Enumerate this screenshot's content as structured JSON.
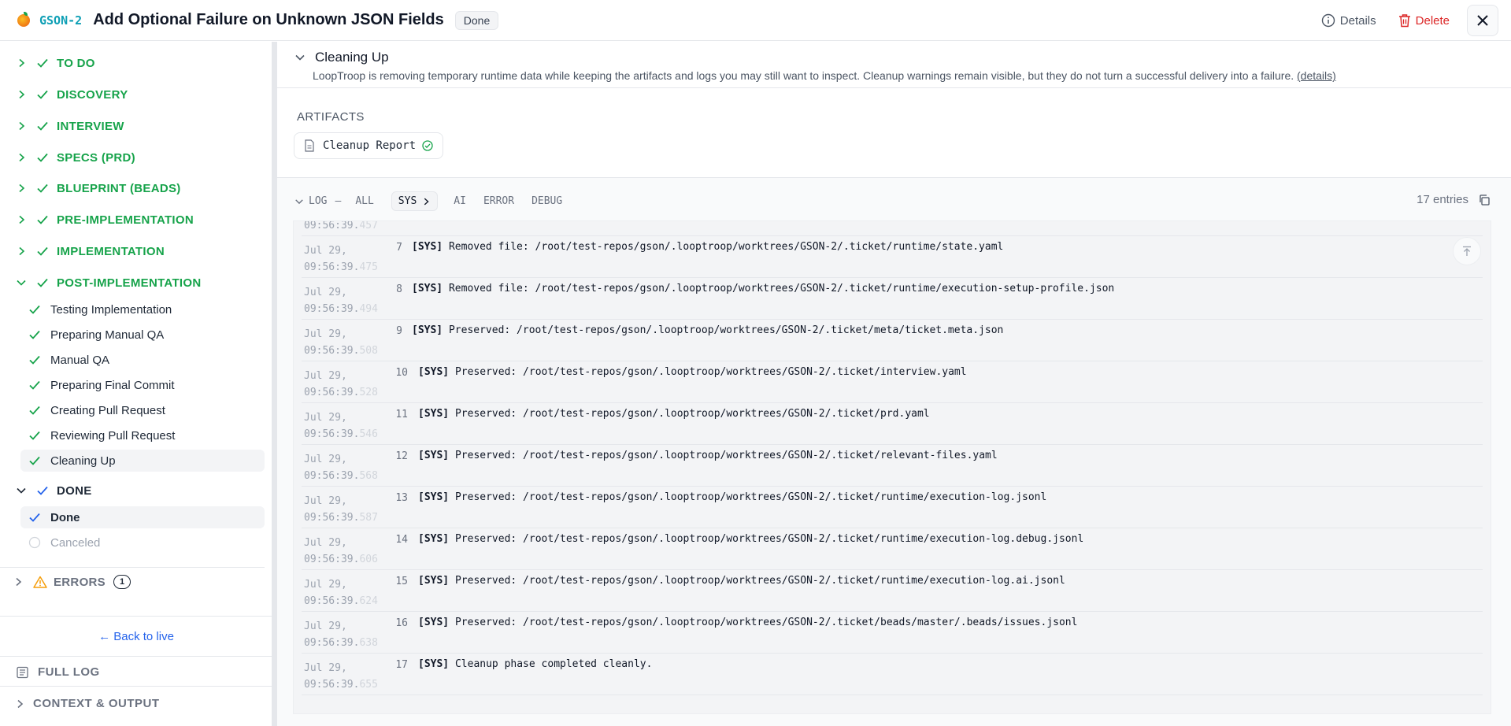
{
  "header": {
    "ticket_id": "GSON-2",
    "title": "Add Optional Failure on Unknown JSON Fields",
    "status": "Done",
    "details_label": "Details",
    "delete_label": "Delete"
  },
  "sidebar": {
    "phases": [
      {
        "label": "TO DO"
      },
      {
        "label": "DISCOVERY"
      },
      {
        "label": "INTERVIEW"
      },
      {
        "label": "SPECS (PRD)"
      },
      {
        "label": "BLUEPRINT (BEADS)"
      },
      {
        "label": "PRE-IMPLEMENTATION"
      },
      {
        "label": "IMPLEMENTATION"
      },
      {
        "label": "POST-IMPLEMENTATION"
      }
    ],
    "post_steps": [
      {
        "label": "Testing Implementation"
      },
      {
        "label": "Preparing Manual QA"
      },
      {
        "label": "Manual QA"
      },
      {
        "label": "Preparing Final Commit"
      },
      {
        "label": "Creating Pull Request"
      },
      {
        "label": "Reviewing Pull Request"
      },
      {
        "label": "Cleaning Up"
      }
    ],
    "done_phase": {
      "label": "DONE"
    },
    "done_steps": [
      {
        "label": "Done"
      },
      {
        "label": "Canceled"
      }
    ],
    "errors": {
      "label": "ERRORS",
      "count": "1"
    },
    "back_to_live": "← Back to live",
    "full_log": "FULL LOG",
    "context_output": "CONTEXT & OUTPUT"
  },
  "main": {
    "section_title": "Cleaning Up",
    "description": "LoopTroop is removing temporary runtime data while keeping the artifacts and logs you may still want to inspect. Cleanup warnings remain visible, but they do not turn a successful delivery into a failure.",
    "details_link": "(details)",
    "artifacts_label": "ARTIFACTS",
    "artifact": "Cleanup Report",
    "log": {
      "label": "LOG",
      "dash": "—",
      "tabs": [
        "ALL",
        "SYS",
        "AI",
        "ERROR",
        "DEBUG"
      ],
      "entries_count": "17 entries",
      "partial_time": {
        "hms": "09:56:39.",
        "ms": "457"
      },
      "rows": [
        {
          "date": "Jul 29,",
          "hms": "09:56:39.",
          "ms": "475",
          "num": "7",
          "tag": "[SYS]",
          "msg": "Removed file: /root/test-repos/gson/.looptroop/worktrees/GSON-2/.ticket/runtime/state.yaml"
        },
        {
          "date": "Jul 29,",
          "hms": "09:56:39.",
          "ms": "494",
          "num": "8",
          "tag": "[SYS]",
          "msg": "Removed file: /root/test-repos/gson/.looptroop/worktrees/GSON-2/.ticket/runtime/execution-setup-profile.json"
        },
        {
          "date": "Jul 29,",
          "hms": "09:56:39.",
          "ms": "508",
          "num": "9",
          "tag": "[SYS]",
          "msg": "Preserved: /root/test-repos/gson/.looptroop/worktrees/GSON-2/.ticket/meta/ticket.meta.json"
        },
        {
          "date": "Jul 29,",
          "hms": "09:56:39.",
          "ms": "528",
          "num": "10",
          "tag": "[SYS]",
          "msg": "Preserved: /root/test-repos/gson/.looptroop/worktrees/GSON-2/.ticket/interview.yaml"
        },
        {
          "date": "Jul 29,",
          "hms": "09:56:39.",
          "ms": "546",
          "num": "11",
          "tag": "[SYS]",
          "msg": "Preserved: /root/test-repos/gson/.looptroop/worktrees/GSON-2/.ticket/prd.yaml"
        },
        {
          "date": "Jul 29,",
          "hms": "09:56:39.",
          "ms": "568",
          "num": "12",
          "tag": "[SYS]",
          "msg": "Preserved: /root/test-repos/gson/.looptroop/worktrees/GSON-2/.ticket/relevant-files.yaml"
        },
        {
          "date": "Jul 29,",
          "hms": "09:56:39.",
          "ms": "587",
          "num": "13",
          "tag": "[SYS]",
          "msg": "Preserved: /root/test-repos/gson/.looptroop/worktrees/GSON-2/.ticket/runtime/execution-log.jsonl"
        },
        {
          "date": "Jul 29,",
          "hms": "09:56:39.",
          "ms": "606",
          "num": "14",
          "tag": "[SYS]",
          "msg": "Preserved: /root/test-repos/gson/.looptroop/worktrees/GSON-2/.ticket/runtime/execution-log.debug.jsonl"
        },
        {
          "date": "Jul 29,",
          "hms": "09:56:39.",
          "ms": "624",
          "num": "15",
          "tag": "[SYS]",
          "msg": "Preserved: /root/test-repos/gson/.looptroop/worktrees/GSON-2/.ticket/runtime/execution-log.ai.jsonl"
        },
        {
          "date": "Jul 29,",
          "hms": "09:56:39.",
          "ms": "638",
          "num": "16",
          "tag": "[SYS]",
          "msg": "Preserved: /root/test-repos/gson/.looptroop/worktrees/GSON-2/.ticket/beads/master/.beads/issues.jsonl"
        },
        {
          "date": "Jul 29,",
          "hms": "09:56:39.",
          "ms": "655",
          "num": "17",
          "tag": "[SYS]",
          "msg": "Cleanup phase completed cleanly."
        }
      ]
    }
  },
  "colors": {
    "accent": "#16a34a",
    "brand_id": "#0e9fb5",
    "danger": "#dc2626",
    "link": "#2563eb",
    "done_check": "#2563eb"
  }
}
